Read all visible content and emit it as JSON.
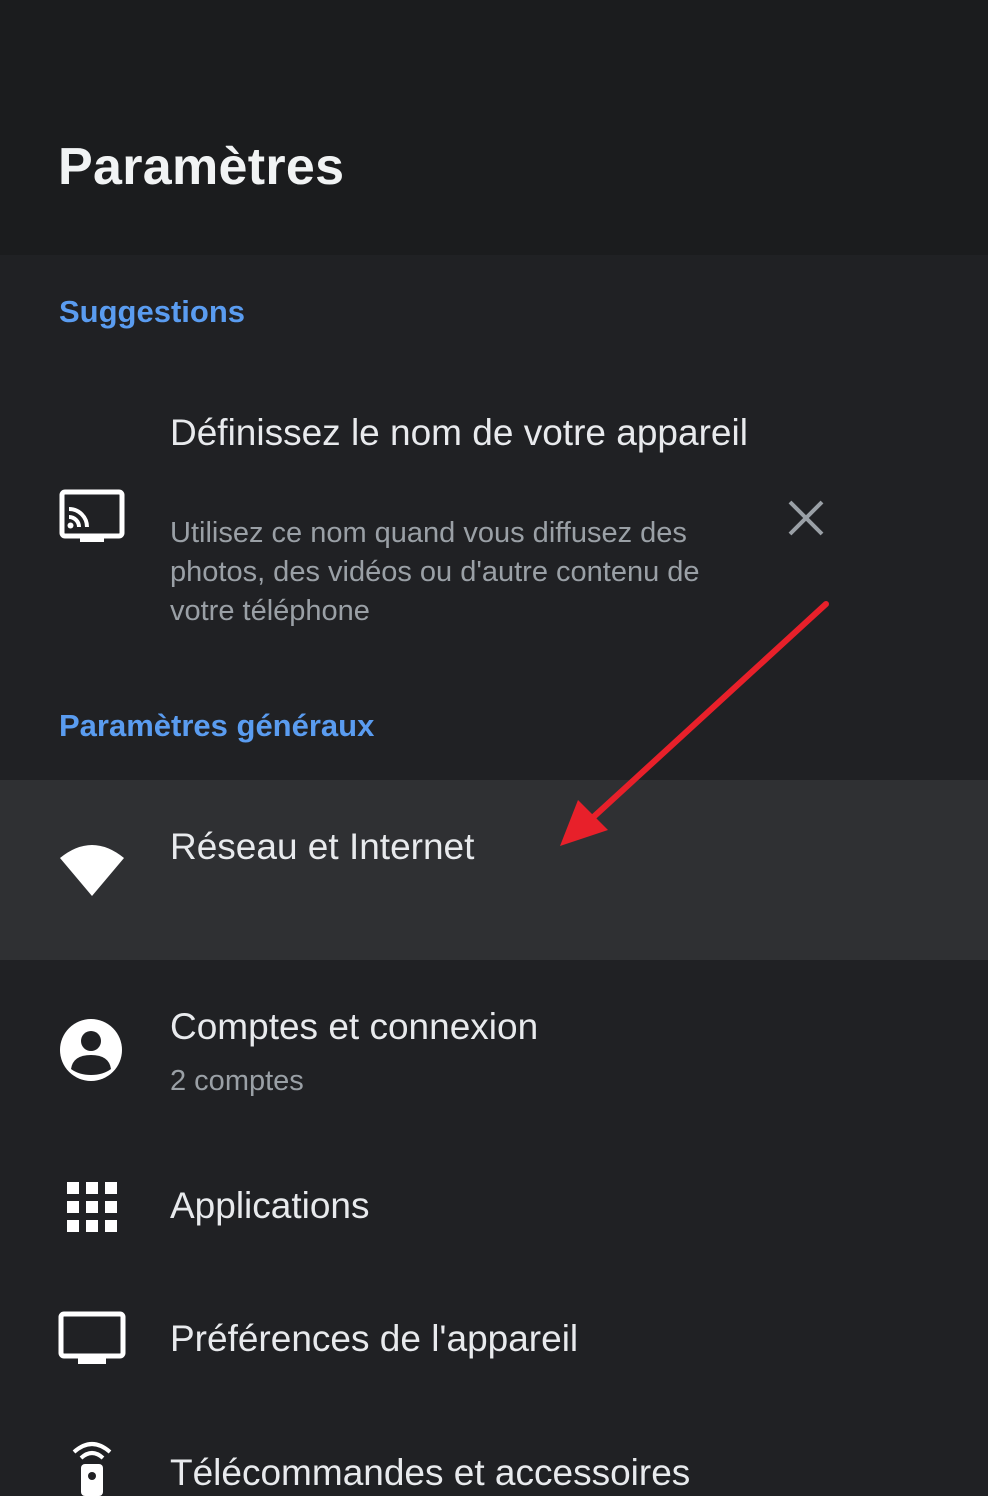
{
  "header": {
    "title": "Paramètres"
  },
  "sections": {
    "suggestions_label": "Suggestions",
    "general_label": "Paramètres généraux"
  },
  "suggestion": {
    "title": "Définissez le nom de votre appareil",
    "description": "Utilisez ce nom quand vous diffusez des photos, des vidéos ou d'autre contenu de votre téléphone",
    "icon": "cast-icon",
    "dismiss_icon": "close-icon"
  },
  "items": [
    {
      "title": "Réseau et Internet",
      "subtitle": "",
      "icon": "wifi-icon",
      "focused": true
    },
    {
      "title": "Comptes et connexion",
      "subtitle": "2 comptes",
      "icon": "account-circle-icon"
    },
    {
      "title": "Applications",
      "subtitle": "",
      "icon": "apps-grid-icon"
    },
    {
      "title": "Préférences de l'appareil",
      "subtitle": "",
      "icon": "tv-icon"
    },
    {
      "title": "Télécommandes et accessoires",
      "subtitle": "",
      "icon": "remote-icon"
    }
  ],
  "colors": {
    "background": "#202124",
    "header_background": "#1b1c1e",
    "focused_row": "#2f3033",
    "section_accent": "#5a9cf0",
    "annotation_arrow": "#e8202a"
  }
}
